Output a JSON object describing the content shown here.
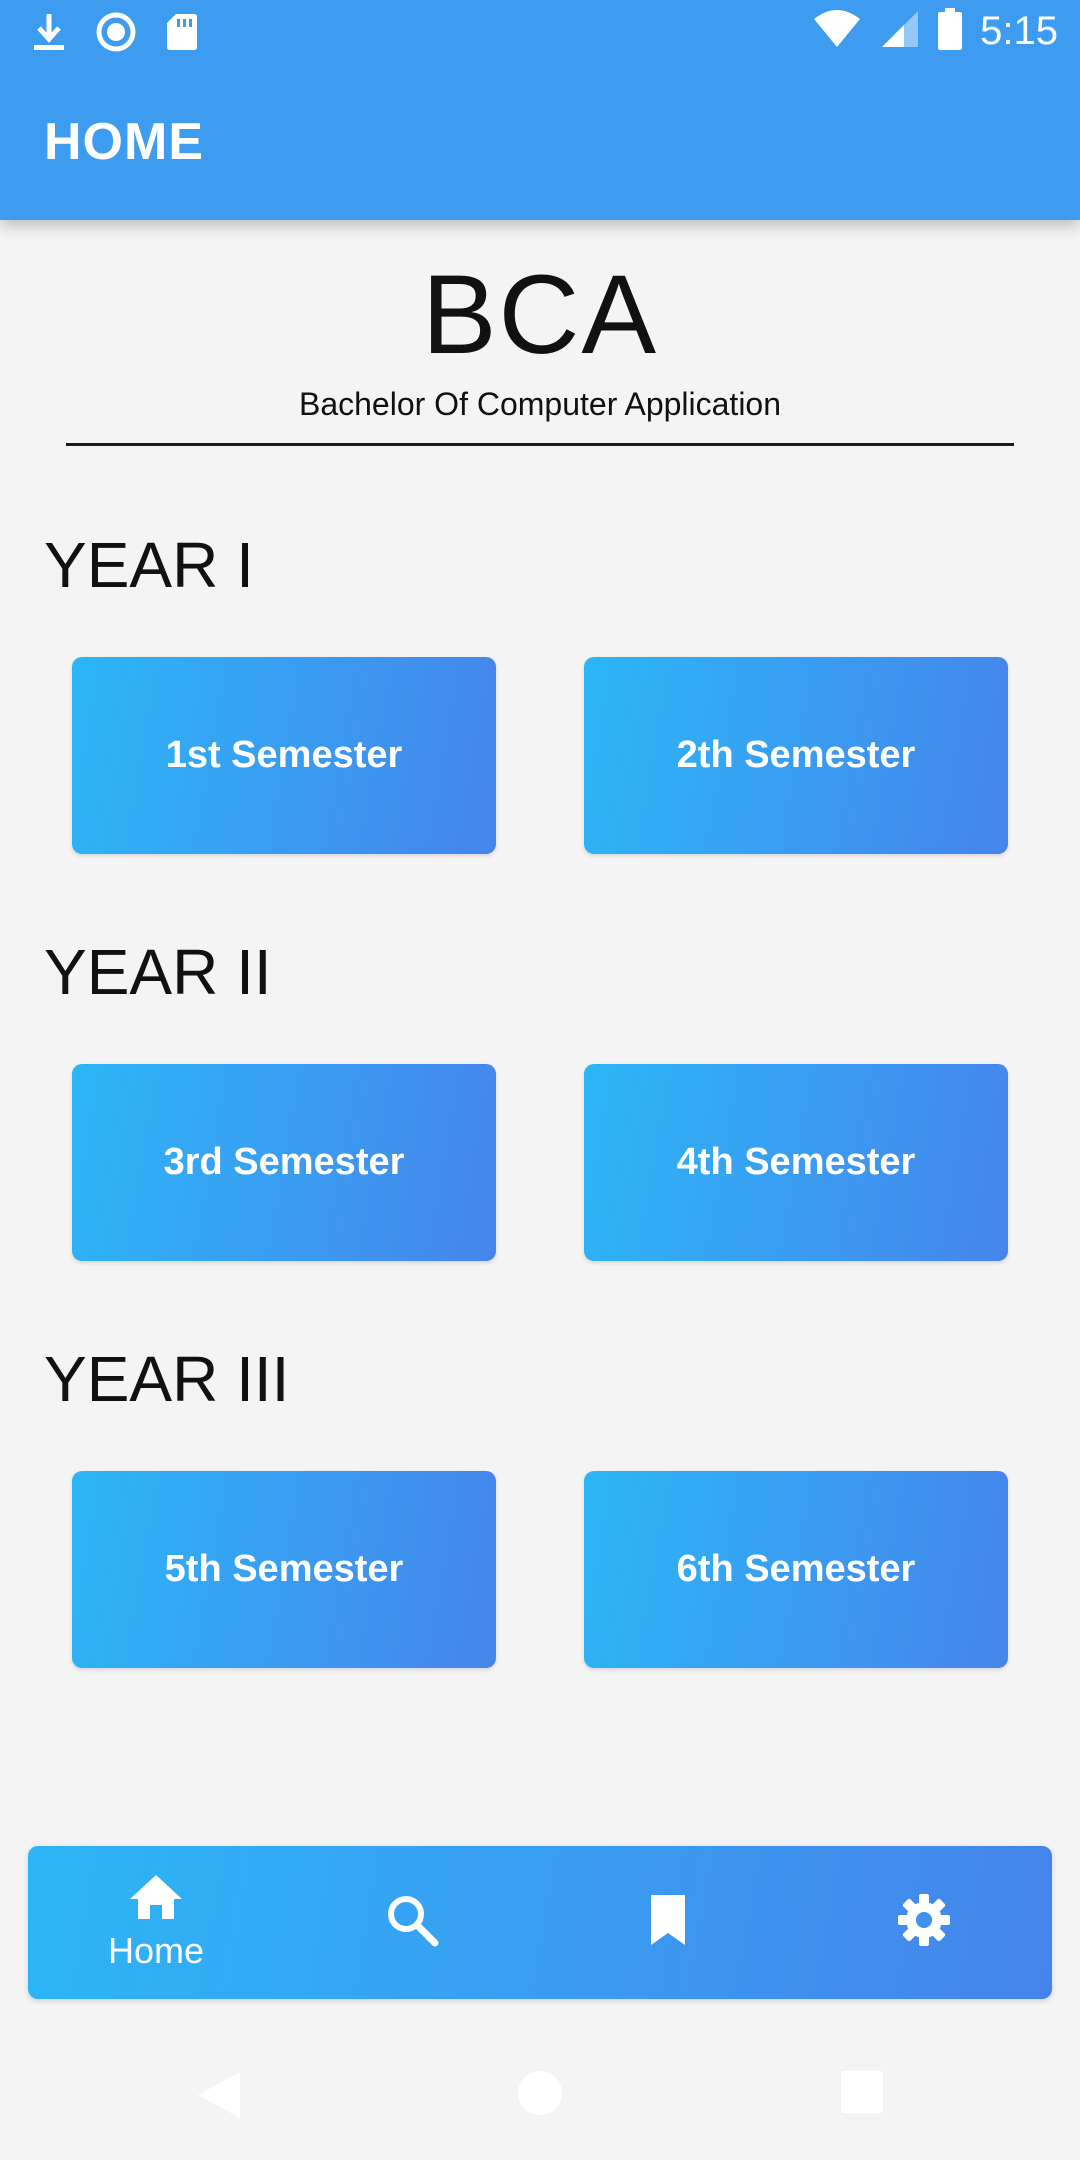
{
  "status_bar": {
    "time": "5:15",
    "icons_left": [
      "download-icon",
      "circle-sync-icon",
      "sd-card-icon"
    ],
    "icons_right": [
      "wifi-icon",
      "cell-signal-icon",
      "battery-icon"
    ]
  },
  "app_bar": {
    "title": "HOME"
  },
  "header": {
    "title": "BCA",
    "subtitle": "Bachelor Of Computer Application"
  },
  "years": [
    {
      "label": "YEAR I",
      "semesters": [
        "1st Semester",
        "2th Semester"
      ]
    },
    {
      "label": "YEAR II",
      "semesters": [
        "3rd Semester",
        "4th Semester"
      ]
    },
    {
      "label": "YEAR III",
      "semesters": [
        "5th Semester",
        "6th Semester"
      ]
    }
  ],
  "bottom_nav": {
    "items": [
      {
        "icon": "home-icon",
        "label": "Home",
        "active": true
      },
      {
        "icon": "search-icon",
        "label": "",
        "active": false
      },
      {
        "icon": "bookmark-icon",
        "label": "",
        "active": false
      },
      {
        "icon": "settings-gear-icon",
        "label": "",
        "active": false
      }
    ]
  },
  "colors": {
    "app_bar": "#3d9cf0",
    "gradient_start": "#2cb6f6",
    "gradient_end": "#4684ec",
    "background": "#f4f4f4"
  }
}
